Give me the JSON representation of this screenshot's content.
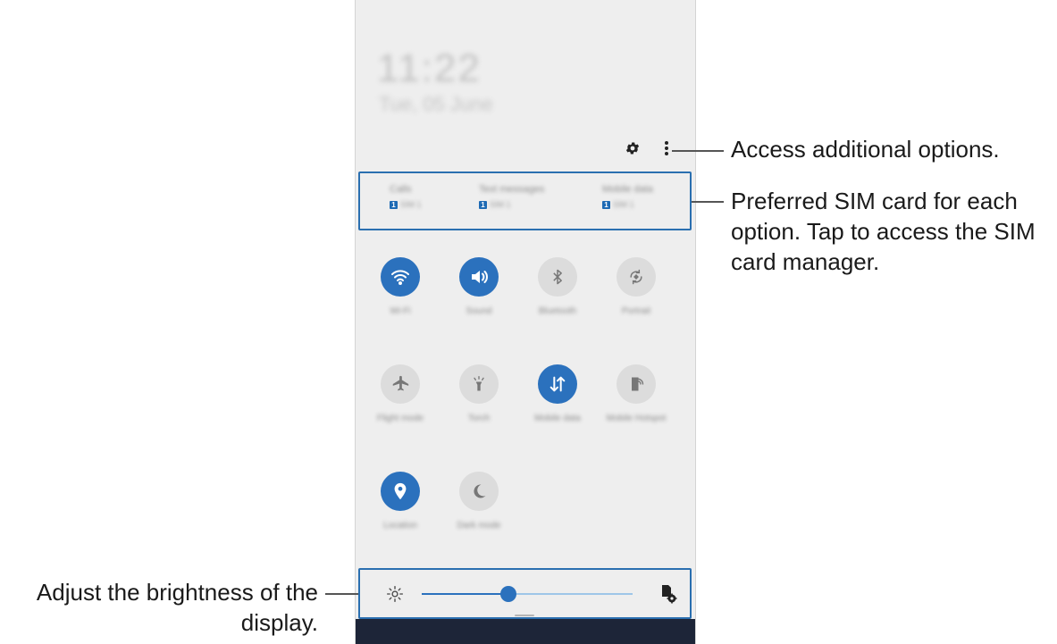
{
  "annotations": {
    "options": "Access additional options.",
    "sim": "Preferred SIM card for each option. Tap to access the SIM card manager.",
    "brightness": "Adjust the brightness of the display."
  },
  "status": {
    "time": "11:22",
    "date": "Tue, 05 June"
  },
  "top_icons": [
    "gear-icon",
    "more-options-icon"
  ],
  "sim_preferences": [
    {
      "label": "Calls",
      "sim_number": "1",
      "sim_name": "SIM 1"
    },
    {
      "label": "Text messages",
      "sim_number": "1",
      "sim_name": "SIM 1"
    },
    {
      "label": "Mobile data",
      "sim_number": "1",
      "sim_name": "SIM 1"
    }
  ],
  "quick_settings": [
    {
      "label": "Wi-Fi",
      "icon": "wifi-icon",
      "active": true
    },
    {
      "label": "Sound",
      "icon": "volume-icon",
      "active": true
    },
    {
      "label": "Bluetooth",
      "icon": "bluetooth-icon",
      "active": false
    },
    {
      "label": "Portrait",
      "icon": "auto-rotate-icon",
      "active": false
    },
    {
      "label": "Flight mode",
      "icon": "airplane-icon",
      "active": false
    },
    {
      "label": "Torch",
      "icon": "flashlight-icon",
      "active": false
    },
    {
      "label": "Mobile data",
      "icon": "mobile-data-icon",
      "active": true
    },
    {
      "label": "Mobile Hotspot",
      "icon": "hotspot-icon",
      "active": false
    },
    {
      "label": "Location",
      "icon": "location-icon",
      "active": true
    },
    {
      "label": "Dark mode",
      "icon": "dark-mode-icon",
      "active": false
    }
  ],
  "brightness": {
    "level": 0.41
  },
  "colors": {
    "accent": "#2b71bd",
    "callout": "#2a6fb0",
    "panel": "#eeeeee"
  }
}
